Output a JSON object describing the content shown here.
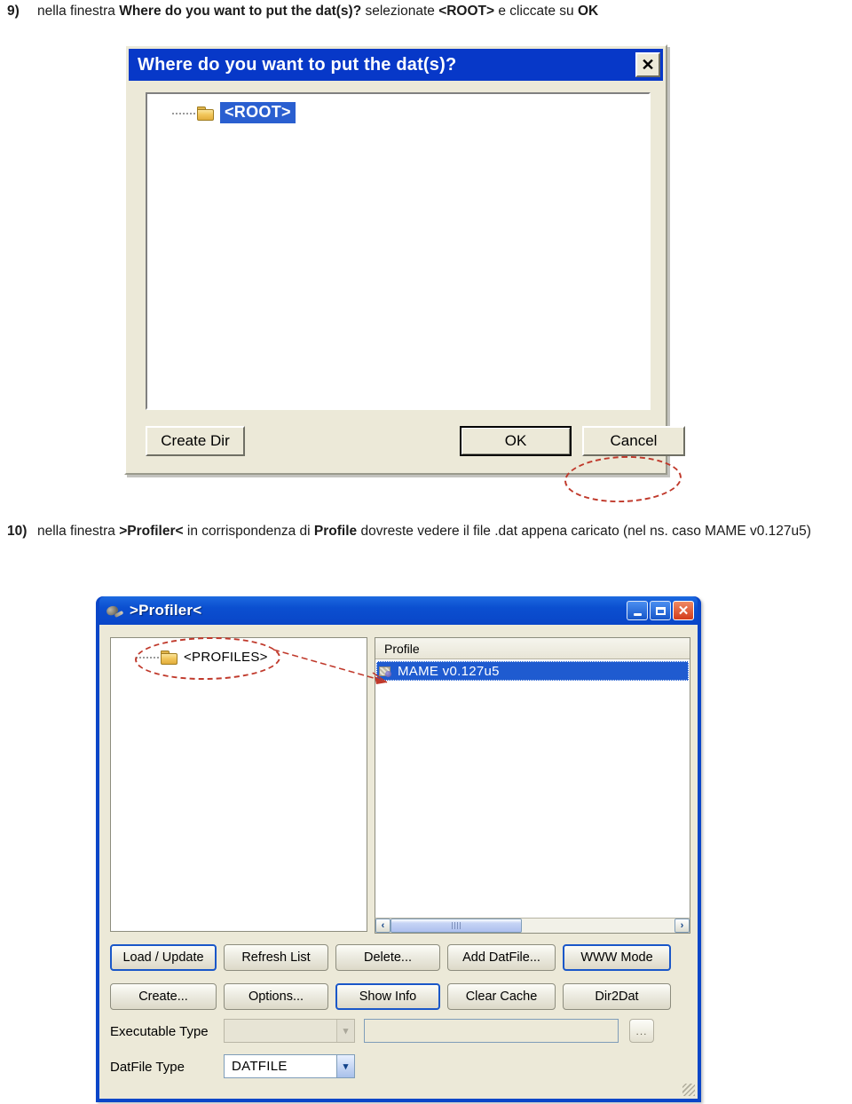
{
  "document": {
    "steps": [
      {
        "number": "9)",
        "segments": [
          {
            "text": "nella finestra ",
            "bold": false
          },
          {
            "text": "Where do you want to put the dat(s)?",
            "bold": true
          },
          {
            "text": " selezionate ",
            "bold": false
          },
          {
            "text": "<ROOT>",
            "bold": true
          },
          {
            "text": " e cliccate su ",
            "bold": false
          },
          {
            "text": "OK",
            "bold": true
          }
        ]
      },
      {
        "number": "10)",
        "segments": [
          {
            "text": "nella finestra ",
            "bold": false
          },
          {
            "text": ">Profiler<",
            "bold": true
          },
          {
            "text": " in corrispondenza di ",
            "bold": false
          },
          {
            "text": "Profile",
            "bold": true
          },
          {
            "text": " dovreste vedere il file .dat appena caricato (nel ns. caso MAME v0.127u5)",
            "bold": false
          }
        ]
      }
    ]
  },
  "dialog_root": {
    "title": "Where do you want to put the dat(s)?",
    "close_label": "✕",
    "tree": {
      "items": [
        {
          "label": "<ROOT>",
          "selected": true
        }
      ]
    },
    "buttons": {
      "create_dir": "Create Dir",
      "ok": "OK",
      "cancel": "Cancel"
    },
    "annotation": {
      "circled_target": "OK"
    },
    "colors": {
      "titlebar": "#0738c8",
      "face": "#ece9d8",
      "selection": "#2a5fd0",
      "annotation_red": "#c0392b"
    }
  },
  "window_profiler": {
    "title": ">Profiler<",
    "titlebar_buttons": {
      "minimize": "minimize",
      "maximize": "maximize",
      "close": "close"
    },
    "tree_panel": {
      "items": [
        {
          "label": "<PROFILES>",
          "selected": false
        }
      ]
    },
    "list_panel": {
      "column_header": "Profile",
      "rows": [
        {
          "label": "MAME v0.127u5",
          "selected": true
        }
      ]
    },
    "scrollbar": {
      "left_arrow": "‹",
      "right_arrow": "›"
    },
    "buttons_row1": [
      {
        "label": "Load / Update",
        "focused": true
      },
      {
        "label": "Refresh List",
        "focused": false
      },
      {
        "label": "Delete...",
        "focused": false
      },
      {
        "label": "Add DatFile...",
        "focused": false
      },
      {
        "label": "WWW Mode",
        "focused": true
      }
    ],
    "buttons_row2": [
      {
        "label": "Create...",
        "focused": false
      },
      {
        "label": "Options...",
        "focused": false
      },
      {
        "label": "Show Info",
        "focused": true
      },
      {
        "label": "Clear Cache",
        "focused": false
      },
      {
        "label": "Dir2Dat",
        "focused": false
      }
    ],
    "fields": {
      "executable_type": {
        "label": "Executable Type",
        "value": "",
        "disabled": true,
        "path_value": "",
        "browse_label": "..."
      },
      "datfile_type": {
        "label": "DatFile Type",
        "value": "DATFILE",
        "disabled": false
      }
    },
    "annotation": {
      "circled_target": "<PROFILES>",
      "arrow_to": "MAME v0.127u5"
    },
    "colors": {
      "titlebar": "#0a46c8",
      "face": "#ece9d8",
      "selection": "#1f5bd0",
      "annotation_red": "#c0392b"
    }
  }
}
